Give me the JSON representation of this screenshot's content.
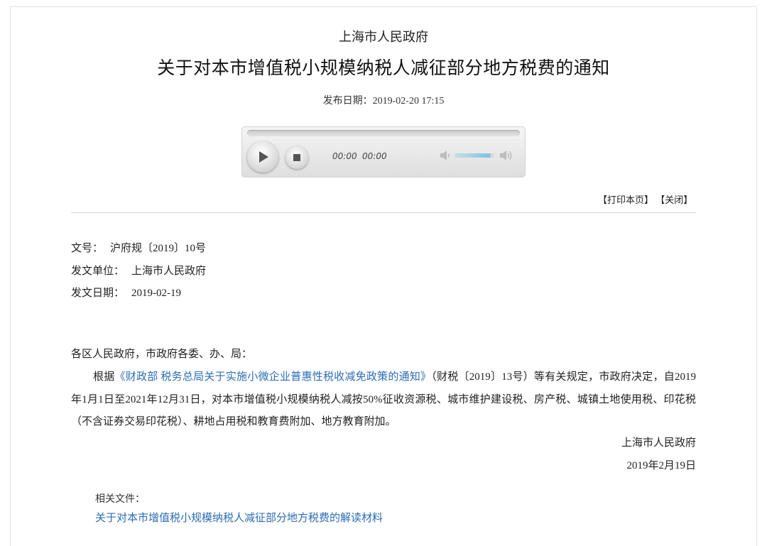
{
  "header": {
    "org": "上海市人民政府",
    "title": "关于对本市增值税小规模纳税人减征部分地方税费的通知",
    "pubdate_label": "发布日期：",
    "pubdate_value": "2019-02-20 17:15"
  },
  "player": {
    "current_time": "00:00",
    "duration": "00:00",
    "icons": {
      "play": "play-icon",
      "stop": "stop-icon",
      "volume_low": "volume-low-icon",
      "volume_high": "volume-high-icon"
    },
    "volume_level": 0.9
  },
  "actions": {
    "print": "【打印本页】",
    "close": "【关闭】"
  },
  "meta": {
    "doc_no_label": "文号：",
    "doc_no_value": "沪府规〔2019〕10号",
    "issuer_label": "发文单位：",
    "issuer_value": "上海市人民政府",
    "issue_date_label": "发文日期：",
    "issue_date_value": "2019-02-19"
  },
  "body": {
    "salutation": "各区人民政府，市政府各委、办、局：",
    "p_before_link": "根据",
    "link_text": "《财政部 税务总局关于实施小微企业普惠性税收减免政策的通知》",
    "p_after_link": "（财税〔2019〕13号）等有关规定，市政府决定，自2019年1月1日至2021年12月31日，对本市增值税小规模纳税人减按50%征收资源税、城市维护建设税、房产税、城镇土地使用税、印花税（不含证券交易印花税）、耕地占用税和教育费附加、地方教育附加。",
    "signature": "上海市人民政府",
    "sign_date": "2019年2月19日"
  },
  "related": {
    "label": "相关文件：",
    "link": "关于对本市增值税小规模纳税人减征部分地方税费的解读材料"
  },
  "colors": {
    "link": "#2b6cb5",
    "rule": "#d5d5d5"
  }
}
